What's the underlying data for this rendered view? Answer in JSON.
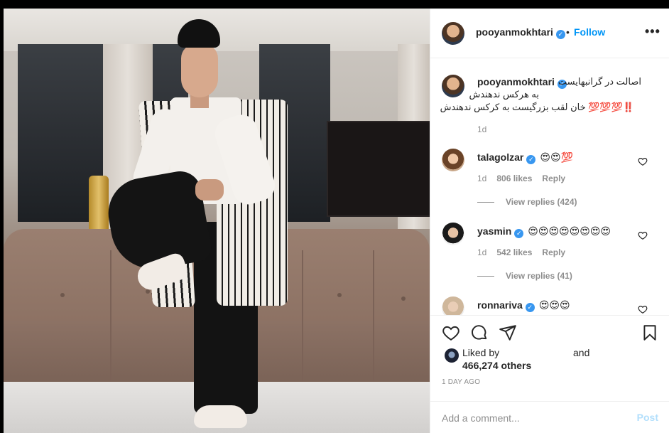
{
  "post": {
    "author": "pooyanmokhtari",
    "follow_label": "Follow",
    "dot": "•",
    "more_label": "•••"
  },
  "caption": {
    "username": "pooyanmokhtari",
    "line1": "اصالت در گرانبهایست",
    "line2": "به هرکس ندهندش",
    "line3": "‼️💯💯💯 خان لقب بزرگیست به کرکس ندهندش",
    "time": "1d"
  },
  "comments": [
    {
      "username": "talagolzar",
      "text": "😍😍💯",
      "time": "1d",
      "likes": "806 likes",
      "reply": "Reply",
      "view_replies": "View replies (424)"
    },
    {
      "username": "yasmin",
      "text": "😍😍😍😍😍😍😍😍",
      "time": "1d",
      "likes": "542 likes",
      "reply": "Reply",
      "view_replies": "View replies (41)"
    },
    {
      "username": "ronnariva",
      "text": "😍😍😍"
    }
  ],
  "likes": {
    "liked_by_label": "Liked by",
    "and_label": "and",
    "count_label": "466,274 others"
  },
  "date_label": "1 DAY AGO",
  "add_comment": {
    "placeholder": "Add a comment...",
    "post_label": "Post"
  },
  "icons": {
    "like": "heart-icon",
    "comment": "comment-icon",
    "share": "paper-plane-icon",
    "save": "bookmark-icon",
    "verified": "verified-badge-icon"
  },
  "colors": {
    "accent": "#0095f6",
    "verified": "#3897f0",
    "muted": "#8e8e8e",
    "post_disabled": "#b2dffc"
  }
}
